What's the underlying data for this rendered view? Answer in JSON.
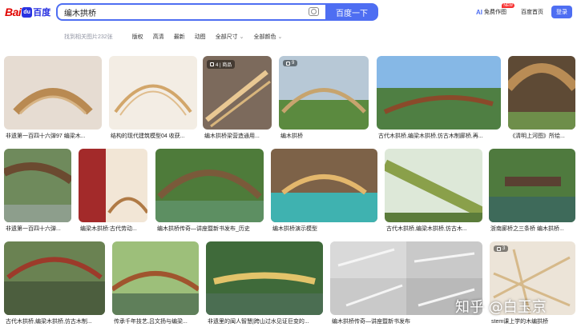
{
  "header": {
    "logo_text": "Bai",
    "logo_text_cn": "百度",
    "search_value": "编木拱桥",
    "search_button": "百度一下",
    "ai_label": "AI",
    "ai_link": "免费作图",
    "new_badge": "NEW",
    "home_link": "百度首页",
    "login_button": "登录"
  },
  "filters": {
    "count": "找到相关图片232张",
    "items": [
      "版权",
      "高清",
      "最新",
      "动图",
      "全部尺寸",
      "全部颜色"
    ]
  },
  "results": [
    {
      "caption": "非遗第一百四十六弹97 编梁木...",
      "badge": ""
    },
    {
      "caption": "结构的现代建筑模型04 收获...",
      "badge": ""
    },
    {
      "caption": "编木拱桥梁营造通用...",
      "badge": "4 | 商品"
    },
    {
      "caption": "编木拱桥",
      "badge": "9"
    },
    {
      "caption": "古代木拱桥,编梁木拱桥,仿古木制廊桥,再...",
      "badge": ""
    },
    {
      "caption": "《清明上河图》所绘...",
      "badge": ""
    },
    {
      "caption": "非遗第一百四十六弹...",
      "badge": ""
    },
    {
      "caption": "编梁木拱桥:古代劳动...",
      "badge": ""
    },
    {
      "caption": "编木拱桥传奇—讲座暨新书发布_历史",
      "badge": ""
    },
    {
      "caption": "编木拱桥演示模型",
      "badge": ""
    },
    {
      "caption": "古代木拱桥,编梁木拱桥,仿古木...",
      "badge": ""
    },
    {
      "caption": "浙南廊桥之三条桥 编木拱桥...",
      "badge": ""
    },
    {
      "caption": "古代木拱桥,编梁木拱桥,仿古木制...",
      "badge": ""
    },
    {
      "caption": "传承千年技艺,吕文扬与编梁...",
      "badge": ""
    },
    {
      "caption": "非遗里的闽人智慧|跨山过水见证巨变的...",
      "badge": ""
    },
    {
      "caption": "编木拱桥传奇—讲座暨新书发布",
      "badge": ""
    },
    {
      "caption": "stem课上学的木编拱桥",
      "badge": "3"
    }
  ],
  "watermark": "知乎 @白玉京",
  "colors": {
    "accent": "#4e6ef2",
    "brand_red": "#e10602",
    "brand_blue": "#2932e1"
  }
}
